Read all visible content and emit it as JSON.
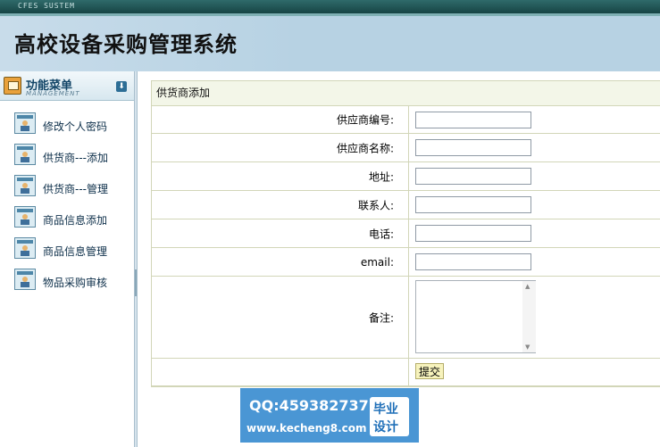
{
  "topbar": {
    "system_label": "CFES SUSTEM"
  },
  "header": {
    "title": "高校设备采购管理系统"
  },
  "sidebar": {
    "heading": "功能菜单",
    "heading_sub": "MANAGEMENT",
    "items": [
      {
        "label": "修改个人密码"
      },
      {
        "label": "供货商---添加"
      },
      {
        "label": "供货商---管理"
      },
      {
        "label": "商品信息添加"
      },
      {
        "label": "商品信息管理"
      },
      {
        "label": "物品采购审核"
      }
    ]
  },
  "form": {
    "caption": "供货商添加",
    "fields": [
      {
        "label": "供应商编号:",
        "value": ""
      },
      {
        "label": "供应商名称:",
        "value": ""
      },
      {
        "label": "地址:",
        "value": ""
      },
      {
        "label": "联系人:",
        "value": ""
      },
      {
        "label": "电话:",
        "value": ""
      },
      {
        "label": "email:",
        "value": ""
      }
    ],
    "remark_label": "备注:",
    "remark_value": "",
    "submit_label": "提交"
  },
  "watermark": {
    "qq": "QQ:459382737",
    "site": "www.kecheng8.com",
    "badge_line1": "毕业",
    "badge_line2": "设计"
  },
  "colors": {
    "header_bg": "#b7d2e3",
    "topbar_bg": "#1f5252",
    "panel_border": "#d2d6b8",
    "watermark_bg": "#4a96d4"
  }
}
